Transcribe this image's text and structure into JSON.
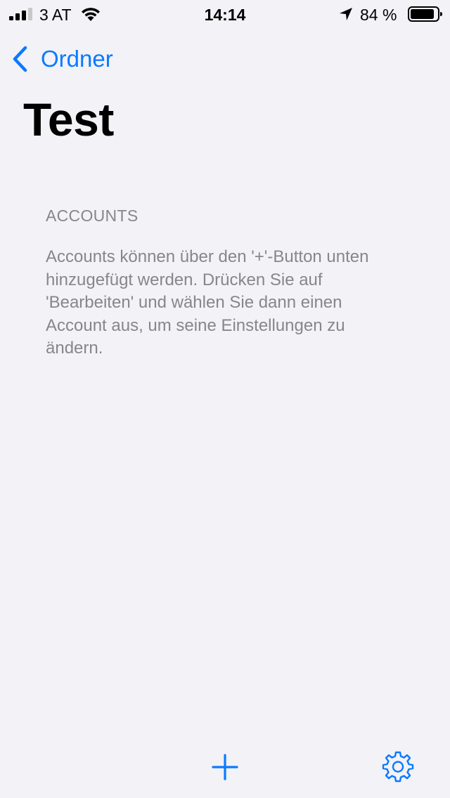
{
  "status_bar": {
    "carrier": "3 AT",
    "time": "14:14",
    "battery_percent": "84 %",
    "icons": [
      "signal-icon",
      "wifi-icon",
      "location-arrow-icon",
      "battery-icon"
    ]
  },
  "nav": {
    "back_label": "Ordner",
    "title": "Test"
  },
  "section": {
    "header": "ACCOUNTS",
    "footer": "Accounts können über den '+'-Button unten hinzugefügt werden. Drücken Sie auf 'Bearbeiten' und wählen Sie dann einen Account aus, um seine Einstellungen zu ändern."
  },
  "toolbar": {
    "icons": [
      "plus-icon",
      "gear-icon"
    ]
  },
  "colors": {
    "accent": "#0a7aff",
    "background": "#f2f2f7",
    "secondary_text": "#86868b"
  }
}
